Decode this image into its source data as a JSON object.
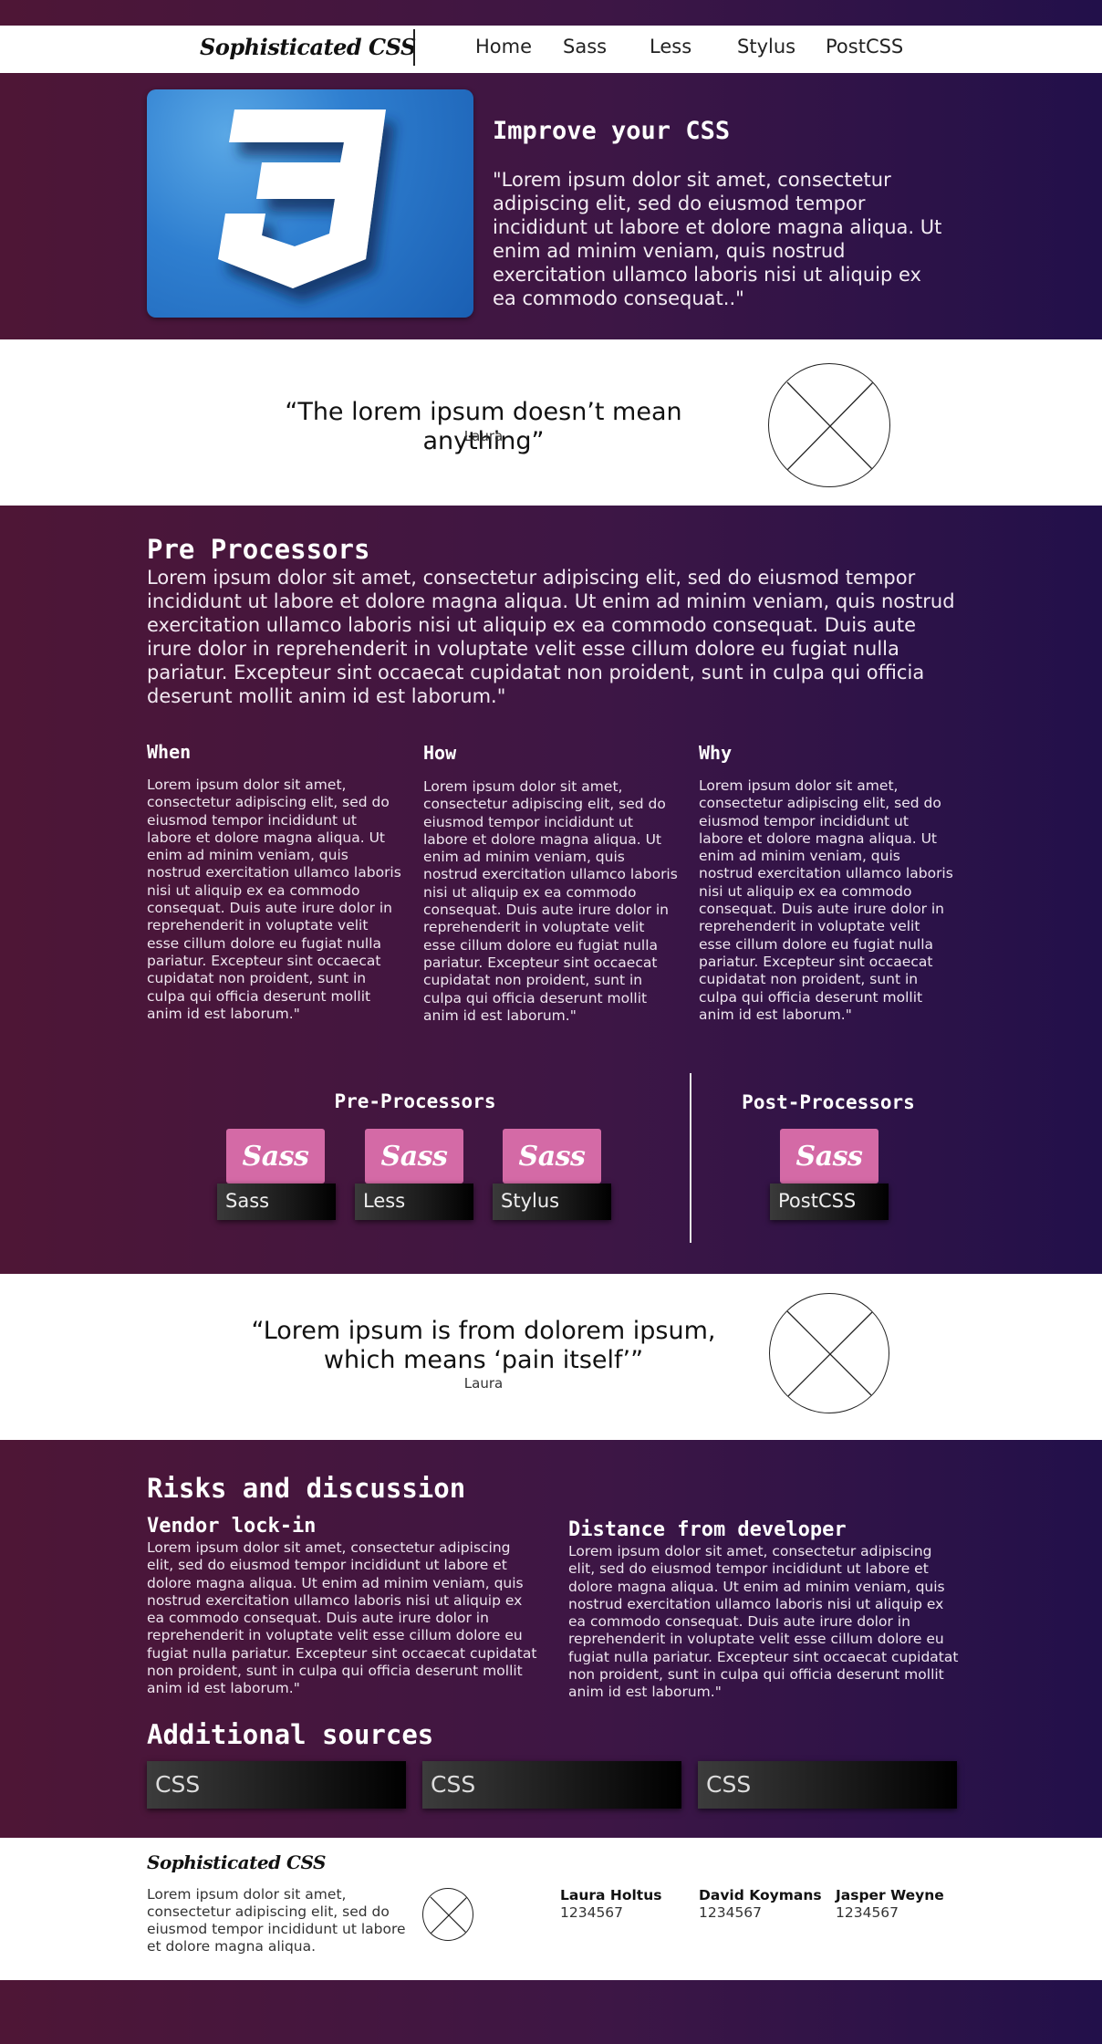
{
  "nav": {
    "logo": "Sophisticated CSS",
    "links": [
      "Home",
      "Sass",
      "Less",
      "Stylus",
      "PostCSS"
    ]
  },
  "hero": {
    "logo_number": "3",
    "title": "Improve your CSS",
    "text": "\"Lorem ipsum dolor sit amet, consectetur adipiscing elit, sed do eiusmod tempor incididunt ut labore et dolore magna aliqua. Ut enim ad minim veniam, quis nostrud exercitation ullamco laboris nisi ut aliquip ex ea commodo consequat..\""
  },
  "quote1": {
    "text": "“The lorem ipsum doesn’t mean anything”",
    "author": "Laura"
  },
  "pre_processors": {
    "title": "Pre Processors",
    "intro": "Lorem ipsum dolor sit amet, consectetur adipiscing elit, sed do eiusmod tempor incididunt ut labore et dolore magna aliqua. Ut enim ad minim veniam, quis nostrud exercitation ullamco laboris nisi ut aliquip ex ea commodo consequat. Duis aute irure dolor in reprehenderit in voluptate velit esse cillum dolore eu fugiat nulla pariatur. Excepteur sint occaecat cupidatat non proident, sunt in culpa qui officia deserunt mollit anim id est laborum.\"",
    "columns": [
      {
        "title": "When",
        "text": "Lorem ipsum dolor sit amet, consectetur adipiscing elit, sed do eiusmod tempor incididunt ut labore et dolore magna aliqua. Ut enim ad minim veniam, quis nostrud exercitation ullamco laboris nisi ut aliquip ex ea commodo consequat. Duis aute irure dolor in reprehenderit in voluptate velit esse cillum dolore eu fugiat nulla pariatur. Excepteur sint occaecat cupidatat non proident, sunt in culpa qui officia deserunt mollit anim id est laborum.\""
      },
      {
        "title": "How",
        "text": "Lorem ipsum dolor sit amet, consectetur adipiscing elit, sed do eiusmod tempor incididunt ut labore et dolore magna aliqua. Ut enim ad minim veniam, quis nostrud exercitation ullamco laboris nisi ut aliquip ex ea commodo consequat. Duis aute irure dolor in reprehenderit in voluptate velit esse cillum dolore eu fugiat nulla pariatur. Excepteur sint occaecat cupidatat non proident, sunt in culpa qui officia deserunt mollit anim id est laborum.\""
      },
      {
        "title": "Why",
        "text": "Lorem ipsum dolor sit amet, consectetur adipiscing elit, sed do eiusmod tempor incididunt ut labore et dolore magna aliqua. Ut enim ad minim veniam, quis nostrud exercitation ullamco laboris nisi ut aliquip ex ea commodo consequat. Duis aute irure dolor in reprehenderit in voluptate velit esse cillum dolore eu fugiat nulla pariatur. Excepteur sint occaecat cupidatat non proident, sunt in culpa qui officia deserunt mollit anim id est laborum.\""
      }
    ]
  },
  "processors": {
    "pre_title": "Pre-Processors",
    "post_title": "Post-Processors",
    "card_logo": "Sass",
    "pre": [
      "Sass",
      "Less",
      "Stylus"
    ],
    "post": [
      "PostCSS"
    ],
    "card_color": "#d46aa6"
  },
  "quote2": {
    "text": "“Lorem ipsum is from dolorem ipsum, which means ‘pain itself’”",
    "author": "Laura"
  },
  "risks": {
    "title": "Risks and discussion",
    "items": [
      {
        "title": "Vendor lock-in",
        "text": "Lorem ipsum dolor sit amet, consectetur adipiscing elit, sed do eiusmod tempor incididunt ut labore et dolore magna aliqua. Ut enim ad minim veniam, quis nostrud exercitation ullamco laboris nisi ut aliquip ex ea commodo consequat. Duis aute irure dolor in reprehenderit in voluptate velit esse cillum dolore eu fugiat nulla pariatur. Excepteur sint occaecat cupidatat non proident, sunt in culpa qui officia deserunt mollit anim id est laborum.\""
      },
      {
        "title": "Distance from developer",
        "text": "Lorem ipsum dolor sit amet, consectetur adipiscing elit, sed do eiusmod tempor incididunt ut labore et dolore magna aliqua. Ut enim ad minim veniam, quis nostrud exercitation ullamco laboris nisi ut aliquip ex ea commodo consequat. Duis aute irure dolor in reprehenderit in voluptate velit esse cillum dolore eu fugiat nulla pariatur. Excepteur sint occaecat cupidatat non proident, sunt in culpa qui officia deserunt mollit anim id est laborum.\""
      }
    ]
  },
  "sources": {
    "title": "Additional sources",
    "buttons": [
      "CSS",
      "CSS",
      "CSS"
    ]
  },
  "footer": {
    "logo": "Sophisticated CSS",
    "text": "Lorem ipsum dolor sit amet, consectetur adipiscing elit, sed do eiusmod tempor incididunt ut labore et dolore magna aliqua.",
    "contacts": [
      {
        "name": "Laura Holtus",
        "number": "1234567"
      },
      {
        "name": "David Koymans",
        "number": "1234567"
      },
      {
        "name": "Jasper Weyne",
        "number": "1234567"
      }
    ]
  },
  "colors": {
    "gradient_left": "#4e1636",
    "gradient_right": "#22104a",
    "sass_pink": "#d46aa6",
    "css3_blue": "#2f7fd0"
  }
}
